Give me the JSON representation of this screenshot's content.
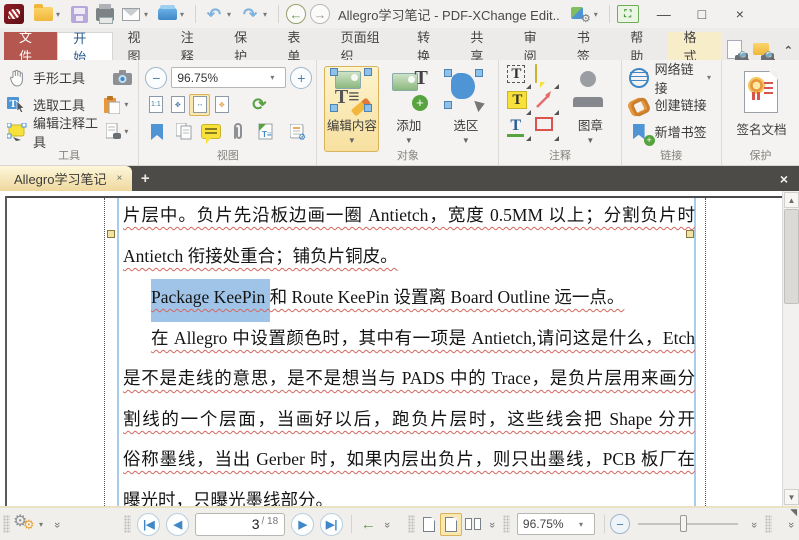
{
  "window": {
    "title": "Allegro学习笔记 - PDF-XChange Edit..",
    "minimize": "—",
    "maximize": "□",
    "close": "×"
  },
  "ribbon": {
    "tabs": [
      {
        "label": "文件"
      },
      {
        "label": "开始"
      },
      {
        "label": "视图"
      },
      {
        "label": "注释"
      },
      {
        "label": "保护"
      },
      {
        "label": "表单"
      },
      {
        "label": "页面组织"
      },
      {
        "label": "转换"
      },
      {
        "label": "共享"
      },
      {
        "label": "审阅"
      },
      {
        "label": "书签"
      },
      {
        "label": "帮助"
      },
      {
        "label": "格式"
      }
    ],
    "groups": {
      "tools": {
        "label": "工具",
        "hand": "手形工具",
        "select": "选取工具",
        "edit_comment": "编辑注释工具"
      },
      "view": {
        "label": "视图",
        "zoom_value": "96.75%"
      },
      "objects": {
        "label": "对象",
        "edit_content": "编辑内容",
        "add": "添加",
        "selection": "选区"
      },
      "comments": {
        "label": "注释",
        "stamp": "图章"
      },
      "links": {
        "label": "链接",
        "web_link": "网络链接",
        "create_link": "创建链接",
        "add_bookmark": "新增书签"
      },
      "protect": {
        "label": "保护",
        "sign": "签名文档"
      }
    }
  },
  "doc_tabs": {
    "active": "Allegro学习笔记",
    "close": "×",
    "add": "+",
    "close_all": "×"
  },
  "document": {
    "lines": [
      {
        "text": "片层中。负片先沿板边画一圈 Antietch，宽度 0.5MM 以上；分割负片时"
      },
      {
        "text": "Antietch 衔接处重合；铺负片铜皮。"
      },
      {
        "selected": "Package KeePin ",
        "rest": "和 Route KeePin 设置离 Board Outline 远一点。"
      },
      {
        "text": "在 Allegro 中设置颜色时，其中有一项是 Antietch,请问这是什么，Etch"
      },
      {
        "text": "是不是走线的意思，是不是想当与 PADS 中的 Trace，是负片层用来画分"
      },
      {
        "text": "割线的一个层面，当画好以后，跑负片层时，这些线会把 Shape 分开"
      },
      {
        "text": "俗称墨线，当出 Gerber 时，如果内层出负片，则只出墨线，PCB 板厂在"
      },
      {
        "text": "曝光时，只曝光墨线部分。"
      }
    ]
  },
  "status": {
    "page_current": "3",
    "page_total": "/ 18",
    "zoom": "96.75%"
  },
  "colors": {
    "accent_red": "#b4574f",
    "highlight_tan": "#fbe8af",
    "selection_blue": "#a0c4e8",
    "doc_tab_bg": "#efd89e"
  }
}
